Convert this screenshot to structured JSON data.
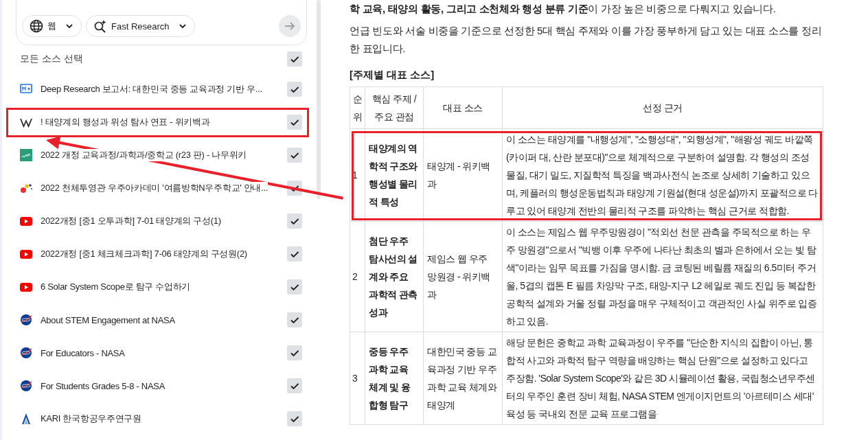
{
  "search_bar": {
    "source_type": {
      "label": "웹"
    },
    "mode": {
      "label": "Fast Research"
    },
    "submit": {
      "disabled": true
    }
  },
  "sources": {
    "select_all": {
      "label": "모든 소스 선택",
      "checked": true
    },
    "items": [
      {
        "kind": "report",
        "title": "Deep Research 보고서: 대한민국 중등 교육과정 기반 우...",
        "checked": true,
        "highlight": false
      },
      {
        "kind": "wiki",
        "title": "! 태양계의 행성과 위성 탐사 연표 - 위키백과",
        "checked": true,
        "highlight": true
      },
      {
        "kind": "namu",
        "title": "2022 개정 교육과정/과학과/중학교 (r23 판) - 나무위키",
        "checked": true,
        "highlight": false
      },
      {
        "kind": "dots",
        "title": "2022 천체투영관 우주아카데미 '여름방학N우주학교' 안내...",
        "checked": true,
        "highlight": false
      },
      {
        "kind": "video",
        "title": "2022개정 [중1 오투과학] 7-01 태양계의 구성(1)",
        "checked": true,
        "highlight": false
      },
      {
        "kind": "video",
        "title": "2022개정 [중1 체크체크과학] 7-06 태양계의 구성원(2)",
        "checked": true,
        "highlight": false
      },
      {
        "kind": "video",
        "title": "6 Solar System Scope로 탐구 수업하기",
        "checked": true,
        "highlight": false
      },
      {
        "kind": "nasa",
        "title": "About STEM Engagement at NASA",
        "checked": true,
        "highlight": false
      },
      {
        "kind": "nasa",
        "title": "For Educators - NASA",
        "checked": true,
        "highlight": false
      },
      {
        "kind": "nasa",
        "title": "For Students Grades 5-8 - NASA",
        "checked": true,
        "highlight": false
      },
      {
        "kind": "kari",
        "title": "KARI 한국항공우주연구원",
        "checked": true,
        "highlight": false
      }
    ]
  },
  "article": {
    "paragraphs": [
      "**학 교육, 태양의 활동, 그리고 소천체와 행성 분류 기준**이 가장 높은 비중으로 다뤄지고 있습니다.",
      "언급 빈도와 서술 비중을 기준으로 선정한 5대 핵심 주제와 이를 가장 풍부하게 담고 있는 대표 소스를 정리한 표입니다."
    ],
    "heading": "[주제별 대표 소스]",
    "table": {
      "columns": [
        "순위",
        "핵심 주제 / 주요 관점",
        "대표 소스",
        "선정 근거"
      ],
      "rows": [
        {
          "rank": "1",
          "topic": "태양계의 역학적 구조와 행성별 물리적 특성",
          "source": "태양계 - 위키백과",
          "reason": "이 소스는 태양계를 \"내행성계\", \"소행성대\", \"외행성계\", \"해왕성 궤도 바깥쪽(카이퍼 대, 산란 분포대)\"으로 체계적으로 구분하여 설명함. 각 행성의 조성 물질, 대기 밀도, 지질학적 특징을 백과사전식 논조로 상세히 기술하고 있으며, 케플러의 행성운동법칙과 태양계 기원설(현대 성운설)까지 포괄적으로 다루고 있어 태양계 전반의 물리적 구조를 파악하는 핵심 근거로 적합함.",
          "highlight": true
        },
        {
          "rank": "2",
          "topic": "첨단 우주 탐사선의 설계와 주요 과학적 관측 성과",
          "source": "제임스 웹 우주 망원경 - 위키백과",
          "reason": "이 소스는 제임스 웹 우주망원경이 \"적외선 천문 관측을 주목적으로 하는 우주 망원경\"으로서 \"빅뱅 이후 우주에 나타난 최초의 별과 은하에서 오는 빛 탐색\"이라는 임무 목표를 가짐을 명시함. 금 코팅된 베릴륨 재질의 6.5미터 주거울, 5겹의 캡톤 E 필름 차양막 구조, 태양-지구 L2 헤일로 궤도 진입 등 복잡한 공학적 설계와 거울 정렬 과정을 매우 구체적이고 객관적인 사실 위주로 입증하고 있음.",
          "highlight": false
        },
        {
          "rank": "3",
          "topic": "중등 우주 과학 교육 체계 및 융합형 탐구",
          "source": "대한민국 중등 교육과정 기반 우주 과학 교육 체계와 태양계",
          "reason": "해당 문헌은 중학교 과학 교육과정이 우주를 \"단순한 지식의 집합이 아닌, 통합적 사고와 과학적 탐구 역량을 배양하는 핵심 단원\"으로 설정하고 있다고 주장함. 'Solar System Scope'와 같은 3D 시뮬레이션 활용, 국립청소년우주센터의 우주인 훈련 장비 체험, NASA STEM 엔게이지먼트의 '아르테미스 세대' 육성 등 국내외 전문 교육 프로그램을",
          "highlight": false
        }
      ]
    }
  }
}
